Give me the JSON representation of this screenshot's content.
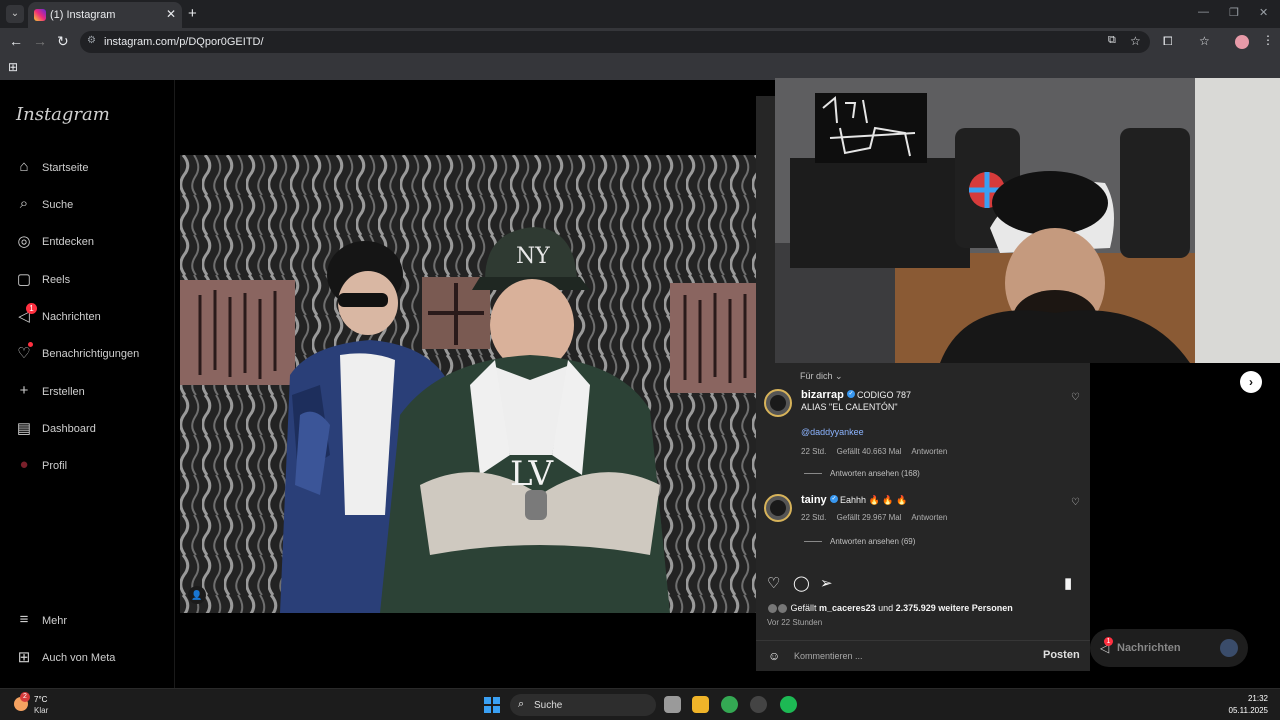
{
  "browser": {
    "tab_title": "(1) Instagram",
    "url": "instagram.com/p/DQpor0GEITD/"
  },
  "sidebar": {
    "logo": "Instagram",
    "items": [
      {
        "label": "Startseite",
        "icon": "home-icon"
      },
      {
        "label": "Suche",
        "icon": "search-icon"
      },
      {
        "label": "Entdecken",
        "icon": "compass-icon"
      },
      {
        "label": "Reels",
        "icon": "reels-icon"
      },
      {
        "label": "Nachrichten",
        "icon": "messenger-icon",
        "badge": "1"
      },
      {
        "label": "Benachrichtigungen",
        "icon": "heart-icon"
      },
      {
        "label": "Erstellen",
        "icon": "plus-icon"
      },
      {
        "label": "Dashboard",
        "icon": "dashboard-icon"
      },
      {
        "label": "Profil",
        "icon": "profile-icon"
      }
    ],
    "bottom": [
      {
        "label": "Mehr",
        "icon": "menu-icon"
      },
      {
        "label": "Auch von Meta",
        "icon": "meta-icon"
      }
    ]
  },
  "panel": {
    "sort_label": "Für dich",
    "comments": [
      {
        "user": "bizarrap",
        "text": "CODIGO 787",
        "line2": "ALIAS \"EL CALENTÓN\"",
        "mention": "@daddyyankee",
        "time": "22 Std.",
        "likes": "Gefällt 40.663 Mal",
        "reply": "Antworten",
        "view_replies": "Antworten ansehen (168)"
      },
      {
        "user": "tainy",
        "text": "Eahhh 🔥 🔥 🔥",
        "time": "22 Std.",
        "likes": "Gefällt 29.967 Mal",
        "reply": "Antworten",
        "view_replies": "Antworten ansehen (69)"
      }
    ],
    "likes_prefix": "Gefällt",
    "likes_user": "m_caceres23",
    "likes_mid": "und",
    "likes_count": "2.375.929 weitere Personen",
    "posted": "Vor 22 Stunden",
    "comment_placeholder": "Kommentieren ...",
    "post_button": "Posten"
  },
  "messages_pill": {
    "label": "Nachrichten",
    "badge": "1"
  },
  "taskbar": {
    "weather_temp": "7°C",
    "weather_cond": "Klar",
    "weather_badge": "2",
    "search": "Suche",
    "time": "21:32",
    "date": "05.11.2025"
  },
  "colors": {
    "accent": "#3897f0",
    "badge": "#ff3040",
    "panel_bg": "#262626"
  }
}
